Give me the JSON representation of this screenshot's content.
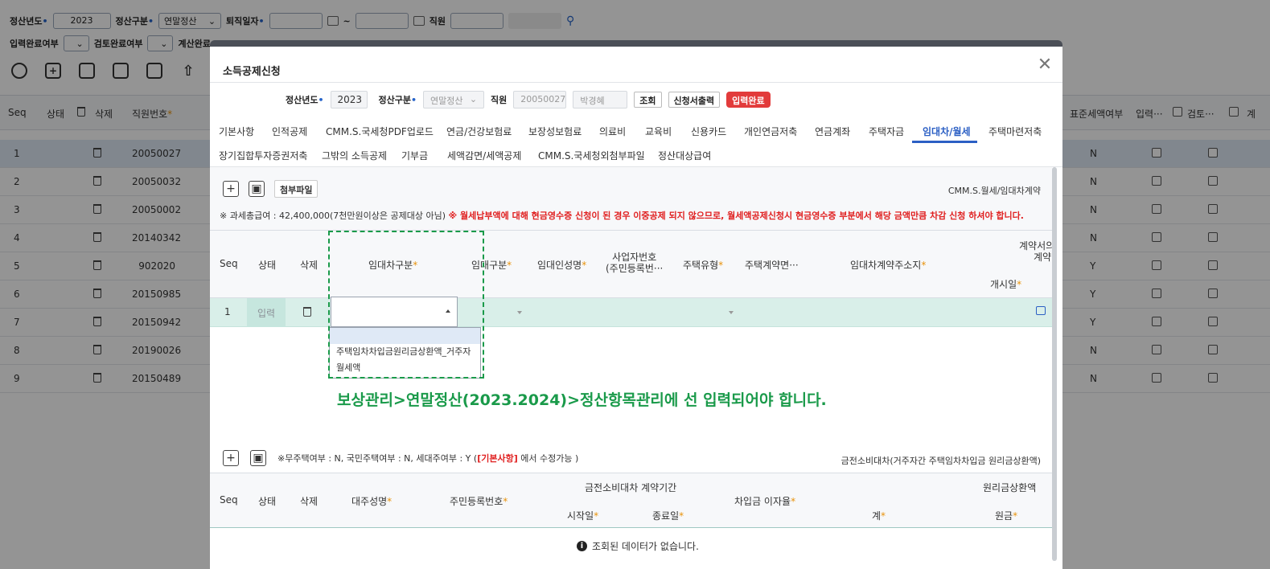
{
  "background": {
    "filters_row1": {
      "year_label": "정산년도",
      "year_value": "2023",
      "type_label": "정산구분",
      "type_value": "연말정산",
      "retire_label": "퇴직일자",
      "range_sep": "~",
      "employee_label": "직원"
    },
    "filters_row2": {
      "input_done_label": "입력완료여부",
      "review_done_label": "검토완료여부",
      "calc_done_label": "계산완료"
    },
    "grid": {
      "headers": {
        "seq": "Seq",
        "status": "상태",
        "delete": "삭제",
        "emp_no": "직원번호",
        "standard_tax": "표준세액여부",
        "input": "입력···",
        "review": "검토···",
        "calc": "계"
      },
      "rows": [
        {
          "seq": "1",
          "emp_no": "20050027",
          "std": "N"
        },
        {
          "seq": "2",
          "emp_no": "20050032",
          "std": "N"
        },
        {
          "seq": "3",
          "emp_no": "20050002",
          "std": "N"
        },
        {
          "seq": "4",
          "emp_no": "20140342",
          "std": "N"
        },
        {
          "seq": "5",
          "emp_no": "902020",
          "std": "Y"
        },
        {
          "seq": "6",
          "emp_no": "20150985",
          "std": "Y"
        },
        {
          "seq": "7",
          "emp_no": "20150942",
          "std": "Y"
        },
        {
          "seq": "8",
          "emp_no": "20190026",
          "std": "N"
        },
        {
          "seq": "9",
          "emp_no": "20150489",
          "std": "N"
        }
      ]
    }
  },
  "modal": {
    "title": "소득공제신청",
    "filters": {
      "year_label": "정산년도",
      "year_value": "2023",
      "type_label": "정산구분",
      "type_value": "연말정산",
      "employee_label": "직원",
      "employee_no": "20050027",
      "employee_name": "박경혜",
      "search_button": "조회",
      "print_button": "신청서출력",
      "done_button": "입력완료"
    },
    "tabs_row1": [
      "기본사항",
      "인적공제",
      "CMM.S.국세청PDF업로드",
      "연금/건강보험료",
      "보장성보험료",
      "의료비",
      "교육비",
      "신용카드",
      "개인연금저축",
      "연금계좌",
      "주택자금",
      "임대차/월세",
      "주택마련저축"
    ],
    "tabs_row2": [
      "장기집합투자증권저축",
      "그밖의 소득공제",
      "기부금",
      "세액감면/세액공제",
      "CMM.S.국세청외첨부파일",
      "정산대상급여"
    ],
    "section1": {
      "attach_button": "첨부파일",
      "right_label": "CMM.S.월세/임대차계약",
      "note_prefix": "※ 과세총급여 : 42,400,000(7천만원이상은 공제대상 아님)",
      "note_warning": "※ 월세납부액에 대해 현금영수증 신청이 된 경우 이중공제 되지 않으므로, 월세액공제신청시 현금영수증 부분에서 해당 금액만큼 차감 신청 하셔야 합니다.",
      "headers": {
        "seq": "Seq",
        "status": "상태",
        "delete": "삭제",
        "lease_type": "임대차구분",
        "rent_type": "임대구분",
        "lessor_name": "임대인성명",
        "biz_no_1": "사업자번호",
        "biz_no_2": "(주민등록번···",
        "house_type": "주택유형",
        "contract_area": "주택계약면···",
        "address": "임대차계약주소지",
        "contract_1": "계약서의",
        "contract_2": "계약",
        "start_date": "개시일"
      },
      "row": {
        "seq": "1",
        "status": "입력"
      },
      "dropdown_options": [
        "주택임차차입금원리금상환액_거주자",
        "월세액"
      ],
      "annotation": "보상관리>연말정산(2023.2024)>정산항목관리에 선 입력되어야 합니다."
    },
    "section2": {
      "note_prefix": "※무주택여부 : N, 국민주택여부 : N, 세대주여부 : Y (",
      "note_keyword": "[기본사항]",
      "note_suffix": "에서 수정가능 )",
      "right_label": "금전소비대차(거주자간 주택임차차입금 원리금상환액)",
      "headers": {
        "seq": "Seq",
        "status": "상태",
        "delete": "삭제",
        "lender_name": "대주성명",
        "resident_no": "주민등록번호",
        "period": "금전소비대차 계약기간",
        "start": "시작일",
        "end": "종료일",
        "interest": "차입금 이자율",
        "repay": "원리금상환액",
        "total": "계",
        "principal": "원금"
      },
      "empty_message": "조회된 데이터가 없습니다."
    }
  }
}
